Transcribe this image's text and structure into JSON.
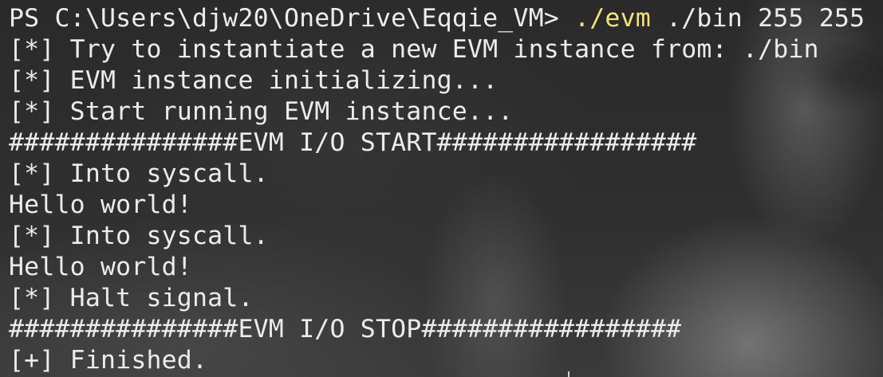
{
  "terminal": {
    "prompt": {
      "path": "PS C:\\Users\\djw20\\OneDrive\\Eqqie_VM> ",
      "command": "./evm",
      "args": " ./bin 255 255"
    },
    "output": [
      "[*] Try to instantiate a new EVM instance from: ./bin",
      "[*] EVM instance initializing...",
      "[*] Start running EVM instance...",
      "###############EVM I/O START#################",
      "[*] Into syscall.",
      "Hello world!",
      "[*] Into syscall.",
      "Hello world!",
      "[*] Halt signal.",
      "###############EVM I/O STOP#################",
      "[+] Finished."
    ]
  },
  "colors": {
    "text": "#ececec",
    "command_highlight": "#f3e27a",
    "background": "#2b2b2b"
  }
}
